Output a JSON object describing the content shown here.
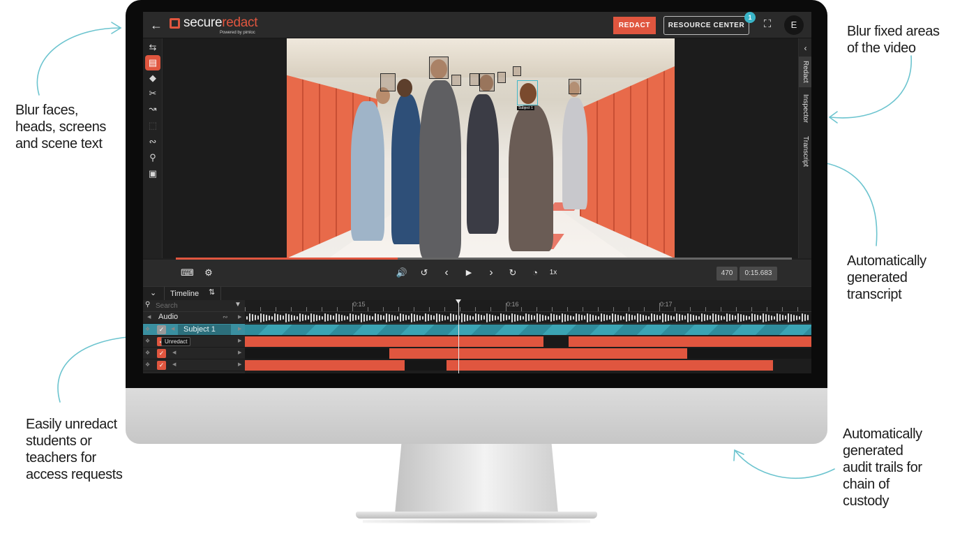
{
  "callouts": {
    "top_left": "Blur faces,\nheads, screens\nand scene text",
    "top_right": "Blur fixed areas\nof the video",
    "mid_right": "Automatically\ngenerated\ntranscript",
    "bottom_left": "Easily unredact\nstudents or\nteachers for\naccess requests",
    "bottom_right": "Automatically\ngenerated\naudit trails for\nchain of\ncustody"
  },
  "colors": {
    "accent": "#e0563f",
    "teal": "#3ab5c8",
    "selection": "#3a8fa0"
  },
  "app": {
    "logo_prefix": "secure",
    "logo_accent": "redact",
    "logo_tagline": "Powered by pimloc",
    "redact_label": "REDACT",
    "resource_label": "RESOURCE CENTER",
    "resource_badge": "1",
    "avatar_initial": "E",
    "back_icon": "arrow-left-icon",
    "fullscreen_icon": "fullscreen-icon"
  },
  "sidebar_tabs": [
    "Redact",
    "Inspector",
    "Transcript"
  ],
  "tools": [
    "swap-icon",
    "redact-list-icon",
    "tag-icon",
    "scissors-icon",
    "motion-icon",
    "box-select-icon",
    "hearing-icon",
    "zoom-icon",
    "region-icon"
  ],
  "player": {
    "speed": "1x",
    "frame": "470",
    "timecode": "0:15.683",
    "progress": 0.36
  },
  "video": {
    "subject_label": "Subject 1"
  },
  "timeline": {
    "title": "Timeline",
    "search_placeholder": "Search",
    "audio_label": "Audio",
    "subject_label": "Subject 1",
    "tooltip": "Unredact",
    "ruler_labels": [
      "0:15",
      "0:16",
      "0:17"
    ]
  }
}
